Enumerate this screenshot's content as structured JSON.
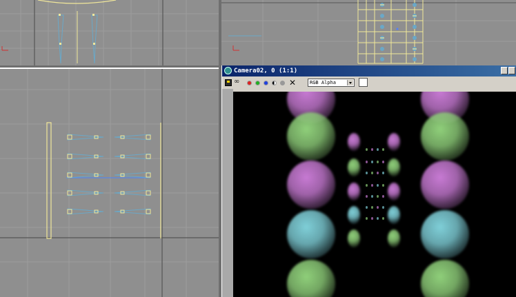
{
  "render_window": {
    "title": "Camera02, 0 (1:1)",
    "channel_select": {
      "selected": "RGB Alpha"
    },
    "toolbar_icons": [
      "save-disk-icon",
      "clone-icon",
      "red-channel-icon",
      "green-channel-icon",
      "blue-channel-icon",
      "monochrome-icon",
      "grey-channel-icon",
      "clear-icon"
    ]
  },
  "viewports": [
    "top-left-viewport",
    "top-right-viewport",
    "bottom-left-viewport",
    "camera-render"
  ],
  "colors": {
    "viewport_bg": "#8f8f8f",
    "object_line": "#f2e89a",
    "wire_blue": "#6aa8c8",
    "sphere_green": "#8fcf7a",
    "sphere_pink": "#c77ad3",
    "sphere_cyan": "#7fcfd8"
  }
}
